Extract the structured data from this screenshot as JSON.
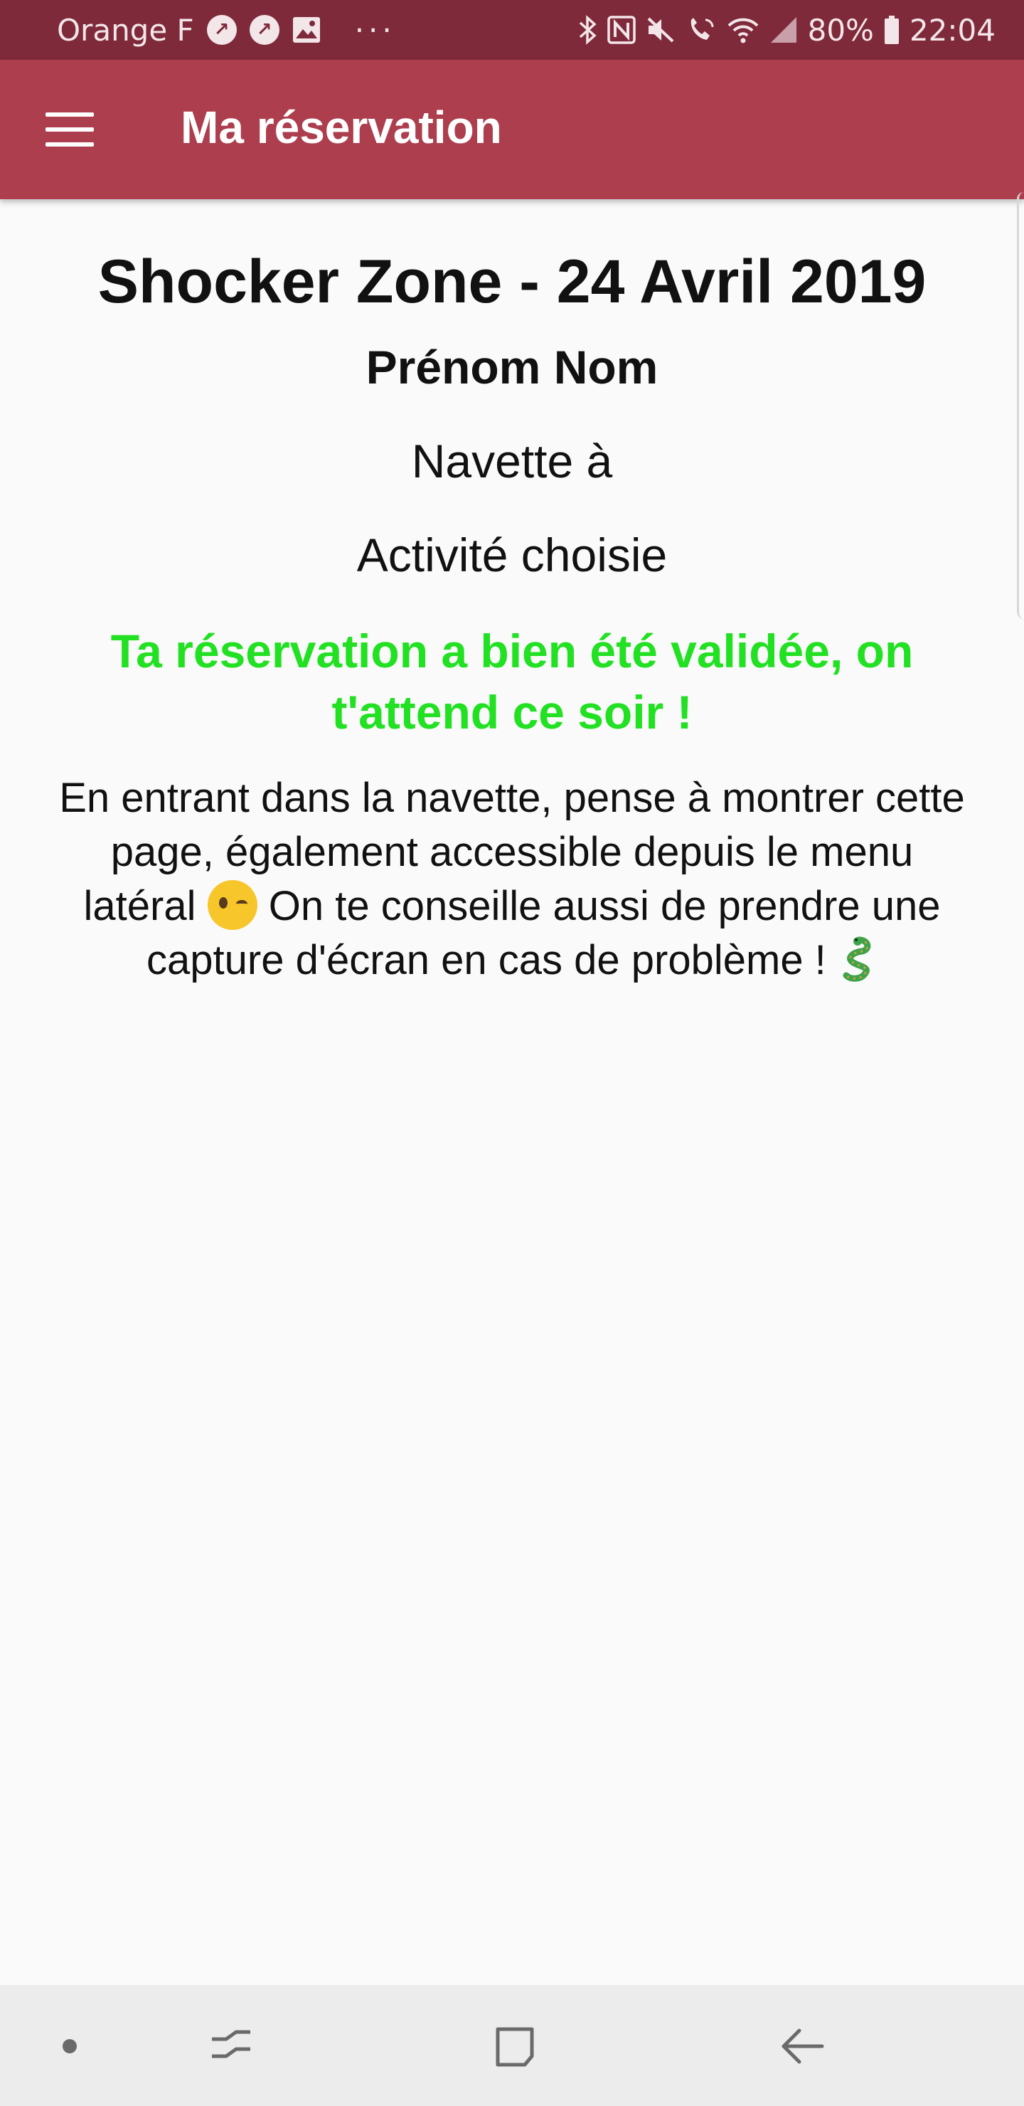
{
  "status_bar": {
    "carrier": "Orange F",
    "more": "···",
    "battery": "80%",
    "time": "22:04"
  },
  "app_bar": {
    "title": "Ma réservation"
  },
  "reservation": {
    "title": "Shocker Zone - 24 Avril 2019",
    "name": "Prénom Nom",
    "shuttle": "Navette à",
    "activity": "Activité choisie",
    "confirmation": "Ta réservation a bien été validée, on t'attend ce soir !",
    "info_part1": "En entrant dans la navette, pense à montrer cette page, également accessible depuis le menu latéral",
    "info_part2": "On te conseille aussi de prendre une capture d'écran en cas de problème !"
  },
  "colors": {
    "status_bar": "#7e2a3a",
    "app_bar": "#ad3e4e",
    "confirmation": "#22e022",
    "background": "#fafafa"
  },
  "icons": {
    "menu": "hamburger-menu-icon",
    "wink": "winking-face-emoji",
    "snake": "snake-emoji",
    "nav_home": "dot-icon",
    "nav_recents": "recents-icon",
    "nav_overview": "square-icon",
    "nav_back": "back-arrow-icon"
  }
}
